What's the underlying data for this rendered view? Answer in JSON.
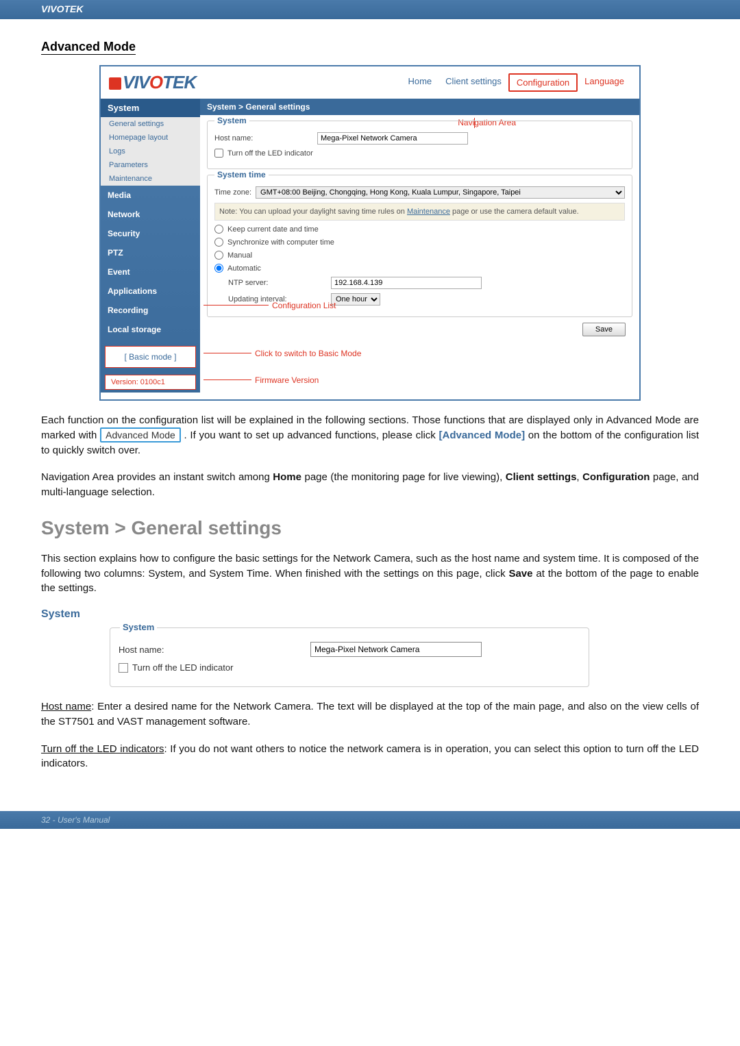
{
  "brand": "VIVOTEK",
  "page_section_title": "Advanced Mode",
  "ss": {
    "logo": "VIVOTEK",
    "nav": {
      "home": "Home",
      "client": "Client settings",
      "config": "Configuration",
      "lang": "Language"
    },
    "breadcrumb": "System  >  General settings",
    "nav_area_label": "Navigation Area",
    "sidebar": {
      "system": "System",
      "subs": [
        "General settings",
        "Homepage layout",
        "Logs",
        "Parameters",
        "Maintenance"
      ],
      "items": [
        "Media",
        "Network",
        "Security",
        "PTZ",
        "Event",
        "Applications",
        "Recording",
        "Local storage"
      ],
      "basic_mode": "[ Basic mode ]",
      "version": "Version: 0100c1"
    },
    "system_box": {
      "legend": "System",
      "host_label": "Host name:",
      "host_value": "Mega-Pixel Network Camera",
      "led": "Turn off the LED indicator"
    },
    "time_box": {
      "legend": "System time",
      "tz_label": "Time zone:",
      "tz_value": "GMT+08:00 Beijing, Chongqing, Hong Kong, Kuala Lumpur, Singapore, Taipei",
      "note_pre": "Note: You can upload your daylight saving time rules on ",
      "note_link": "Maintenance",
      "note_post": " page or use the camera default value.",
      "opt_keep": "Keep current date and time",
      "opt_sync": "Synchronize with computer time",
      "opt_manual": "Manual",
      "opt_auto": "Automatic",
      "ntp_label": "NTP server:",
      "ntp_value": "192.168.4.139",
      "upd_label": "Updating interval:",
      "upd_value": "One hour"
    },
    "save": "Save",
    "callouts": {
      "config_list": "Configuration List",
      "switch": "Click to switch to Basic Mode",
      "fw": "Firmware Version"
    }
  },
  "para1a": "Each function on the configuration list will be explained in the following sections. Those functions that are displayed only in Advanced Mode are marked with ",
  "para1_badge": "Advanced Mode",
  "para1b": ". If you want to set up advanced functions, please click ",
  "para1_link": "[Advanced Mode]",
  "para1c": " on the bottom of the configuration list to quickly switch over.",
  "para2a": "Navigation Area provides an instant switch among ",
  "para2_home": "Home",
  "para2b": " page (the monitoring page for live viewing), ",
  "para2_client": "Client settings",
  "para2c": ", ",
  "para2_config": "Configuration",
  "para2d": " page, and multi-language selection.",
  "h2": "System > General settings",
  "para3a": "This section explains how to configure the basic settings for the Network Camera, such as the host name and system time. It is composed of the following two columns: System, and System Time. When finished with the settings on this page, click ",
  "para3_save": "Save",
  "para3b": " at the bottom of the page to enable the settings.",
  "blue_h": "System",
  "mini": {
    "legend": "System",
    "host_label": "Host name:",
    "host_value": "Mega-Pixel Network Camera",
    "led": "Turn off the LED indicator"
  },
  "para4_u": "Host name",
  "para4": ": Enter a desired name for the Network Camera. The text will be displayed at the top of the main page, and also on the view cells of the ST7501 and VAST management software.",
  "para5_u": "Turn off the LED indicators",
  "para5": ": If you do not want others to notice the network camera is in operation, you can select this option to turn off the LED indicators.",
  "footer": "32 - User's Manual"
}
